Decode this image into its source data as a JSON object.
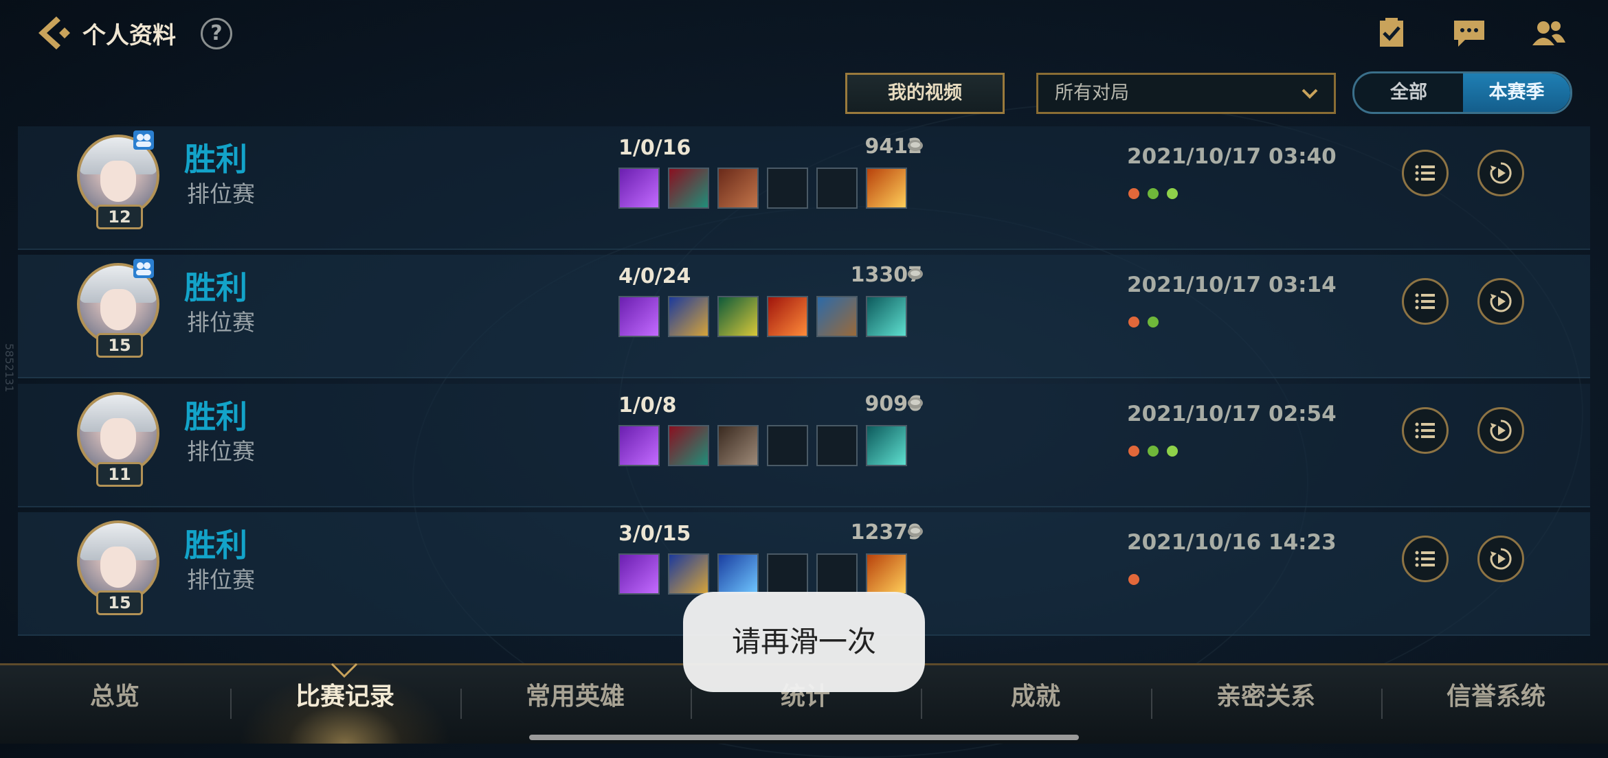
{
  "header": {
    "title": "个人资料",
    "help_symbol": "?"
  },
  "top_icons": [
    "checklist-icon",
    "chat-icon",
    "friends-icon"
  ],
  "filters": {
    "video_button": "我的视频",
    "match_filter": "所有对局",
    "season_all": "全部",
    "season_current": "本赛季"
  },
  "matches": [
    {
      "result": "胜利",
      "mode": "排位赛",
      "level": "12",
      "kda": "1/0/16",
      "gold": "9412",
      "date": "2021/10/17 03:40",
      "items": [
        "purple-staff",
        "red-mask",
        "spellbook",
        "empty",
        "empty",
        "orange-ward"
      ],
      "tags": [
        "orange",
        "flag",
        "green"
      ],
      "party": true
    },
    {
      "result": "胜利",
      "mode": "排位赛",
      "level": "15",
      "kda": "4/0/24",
      "gold": "13307",
      "date": "2021/10/17 03:14",
      "items": [
        "purple-staff",
        "blue-chalice",
        "green-orb",
        "red-orb",
        "blue-armor",
        "teal-ward"
      ],
      "tags": [
        "orange",
        "flag"
      ],
      "party": true
    },
    {
      "result": "胜利",
      "mode": "排位赛",
      "level": "11",
      "kda": "1/0/8",
      "gold": "9096",
      "date": "2021/10/17 02:54",
      "items": [
        "purple-staff",
        "red-mask",
        "brown-stone",
        "empty",
        "empty",
        "teal-ward"
      ],
      "tags": [
        "orange",
        "flag",
        "green"
      ],
      "party": false
    },
    {
      "result": "胜利",
      "mode": "排位赛",
      "level": "15",
      "kda": "3/0/15",
      "gold": "12379",
      "date": "2021/10/16 14:23",
      "items": [
        "purple-staff",
        "blue-chalice",
        "blue-orb",
        "empty",
        "empty",
        "orange-ward"
      ],
      "tags": [
        "orange"
      ],
      "party": false
    }
  ],
  "tabs": [
    "总览",
    "比赛记录",
    "常用英雄",
    "统计",
    "成就",
    "亲密关系",
    "信誉系统"
  ],
  "active_tab": "比赛记录",
  "toast": "请再滑一次",
  "side_watermark": "5852131",
  "colors": {
    "win": "#13a3c9",
    "gold_border": "#b29256",
    "accent_blue": "#1f7fb4"
  }
}
